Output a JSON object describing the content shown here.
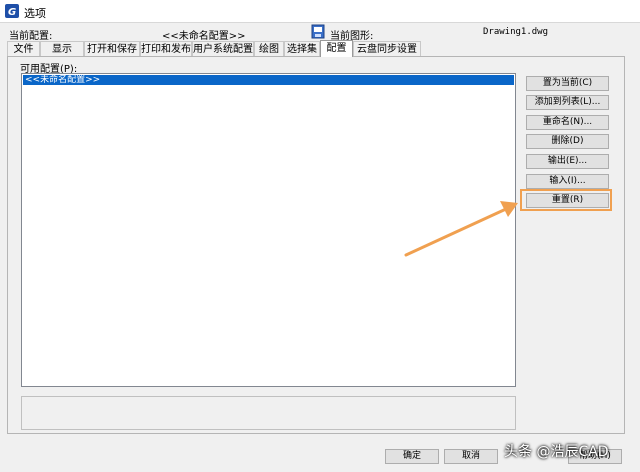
{
  "window": {
    "title": "选项"
  },
  "header": {
    "current_profile_label": "当前配置:",
    "current_profile_value": "<<未命名配置>>",
    "current_drawing_label": "当前图形:",
    "current_drawing_value": "Drawing1.dwg"
  },
  "tabs": [
    {
      "label": "文件"
    },
    {
      "label": "显示"
    },
    {
      "label": "打开和保存"
    },
    {
      "label": "打印和发布"
    },
    {
      "label": "用户系统配置"
    },
    {
      "label": "绘图"
    },
    {
      "label": "选择集"
    },
    {
      "label": "配置"
    },
    {
      "label": "云盘同步设置"
    }
  ],
  "active_tab": "配置",
  "profiles": {
    "label": "可用配置(P):",
    "items": [
      "<<未命名配置>>"
    ]
  },
  "buttons": {
    "set_current": "置为当前(C)",
    "add_to_list": "添加到列表(L)...",
    "rename": "重命名(N)...",
    "delete": "删除(D)",
    "export": "输出(E)...",
    "import": "输入(I)...",
    "reset": "重置(R)"
  },
  "bottom": {
    "ok": "确定",
    "cancel": "取消",
    "help": "帮助(H)"
  },
  "watermark": "头条 @浩辰CAD",
  "colors": {
    "selection": "#0a66c8",
    "highlight": "#f0a050",
    "arrow": "#f0a050"
  }
}
